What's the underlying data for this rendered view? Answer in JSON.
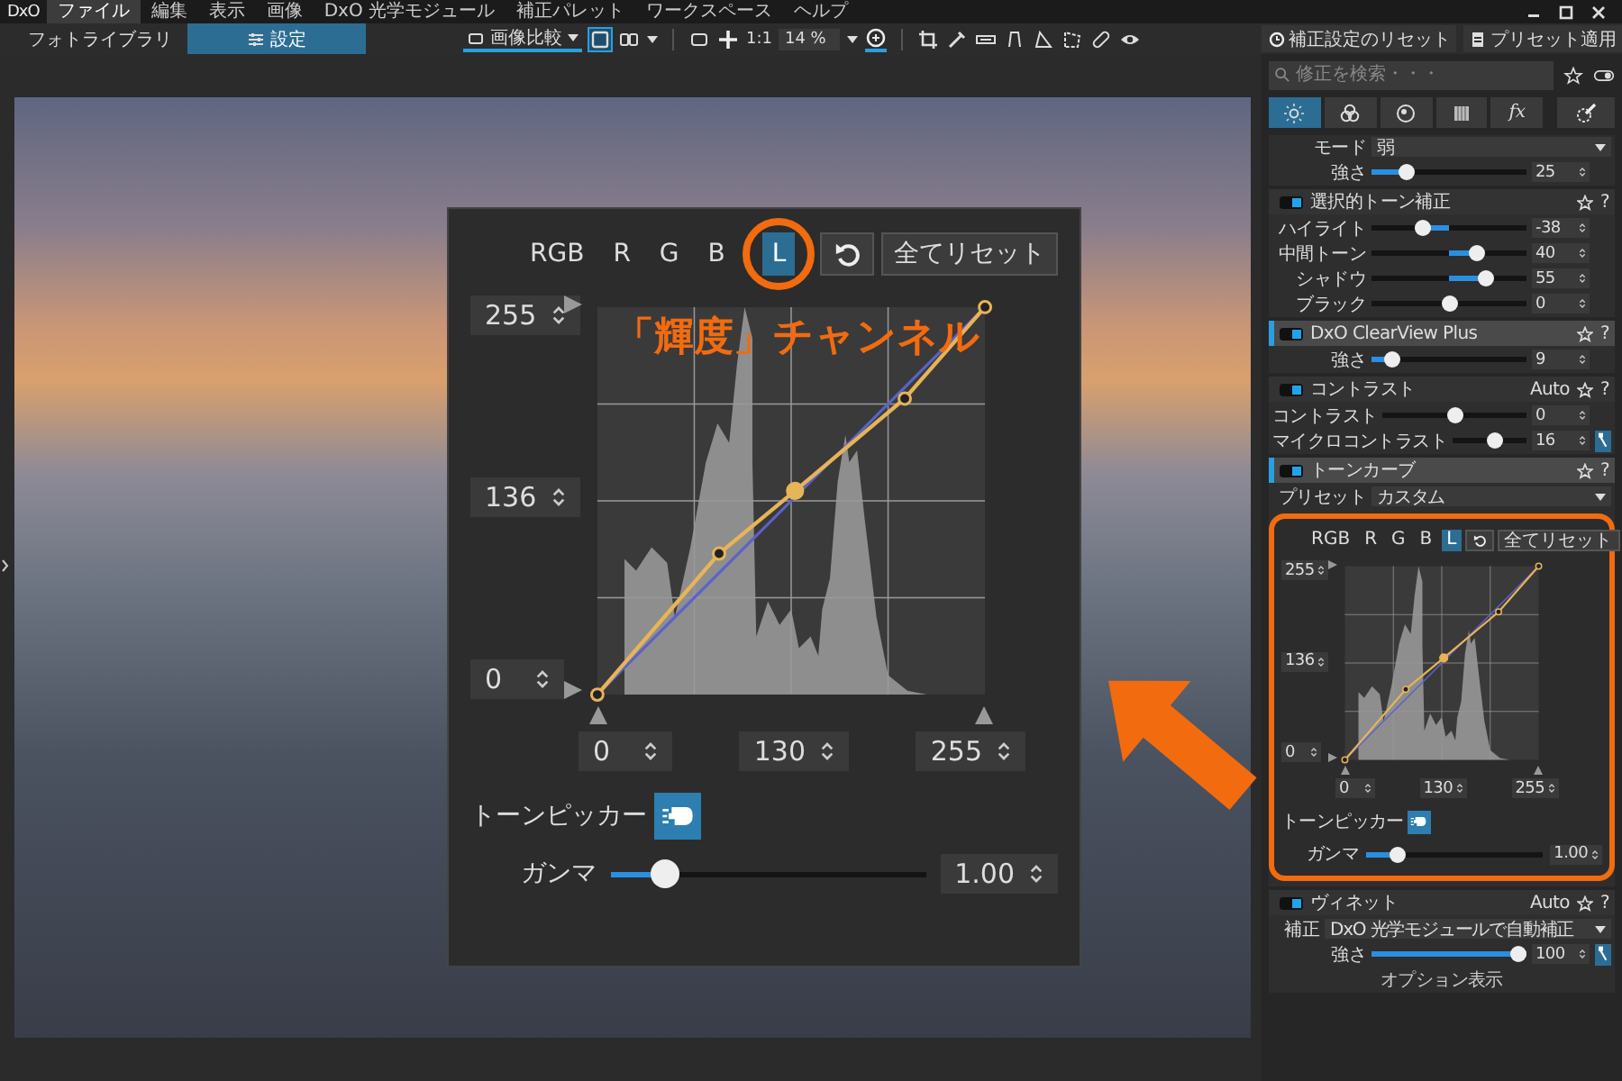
{
  "menu": {
    "logo": "DxO",
    "items": [
      {
        "label": "ファイル",
        "selected": true
      },
      {
        "label": "編集",
        "selected": false
      },
      {
        "label": "表示",
        "selected": false
      },
      {
        "label": "画像",
        "selected": false
      },
      {
        "label": "DxO 光学モジュール",
        "selected": false
      },
      {
        "label": "補正パレット",
        "selected": false
      },
      {
        "label": "ワークスペース",
        "selected": false
      },
      {
        "label": "ヘルプ",
        "selected": false
      }
    ]
  },
  "toolbar": {
    "tabs": [
      {
        "label": "フォトライブラリ",
        "selected": false
      },
      {
        "label": "設定",
        "selected": true
      }
    ],
    "compare": {
      "label": "画像比較",
      "selected": true
    },
    "zoom_ratio": "1:1",
    "zoom": "14 %",
    "reset_button": "補正設定のリセット",
    "preset_button": "プリセット適用"
  },
  "inset": {
    "circle_selected": true,
    "annotation": "「輝度」チャンネル",
    "channels": [
      {
        "label": "RGB",
        "selected": false
      },
      {
        "label": "R",
        "selected": false
      },
      {
        "label": "G",
        "selected": false
      },
      {
        "label": "B",
        "selected": false
      },
      {
        "label": "L",
        "selected": true
      }
    ],
    "reset_all": "全てリセット",
    "y_values": [
      "255",
      "136",
      "0"
    ],
    "x_values": [
      "0",
      "130",
      "255"
    ],
    "picker_label": "トーンピッカー",
    "gamma": {
      "label": "ガンマ",
      "level": 0.14,
      "value": "1.00"
    }
  },
  "palette": {
    "search": {
      "placeholder": "修正を検索・・・"
    },
    "tabs": [
      {
        "kind": "light",
        "selected": true
      },
      {
        "kind": "color",
        "selected": false
      },
      {
        "kind": "detail",
        "selected": false
      },
      {
        "kind": "geometry",
        "selected": false
      },
      {
        "kind": "effects",
        "label": "fx",
        "selected": false
      }
    ],
    "sections": [
      {
        "rows": [
          {
            "kind": "dropdown",
            "label": "モード",
            "value": "弱"
          },
          {
            "kind": "slider",
            "label": "強さ",
            "level": 0.2,
            "value": "25"
          }
        ]
      },
      {
        "title": "選択的トーン補正",
        "on": true,
        "selected": false,
        "help": "?",
        "rows": [
          {
            "kind": "bipolar",
            "label": "ハイライト",
            "level": 0.31,
            "value": "-38"
          },
          {
            "kind": "bipolar",
            "label": "中間トーン",
            "level": 0.7,
            "value": "40"
          },
          {
            "kind": "bipolar",
            "label": "シャドウ",
            "level": 0.77,
            "value": "55"
          },
          {
            "kind": "bipolar",
            "label": "ブラック",
            "level": 0.5,
            "value": "0"
          }
        ]
      },
      {
        "title": "DxO ClearView Plus",
        "on": true,
        "selected": true,
        "help": "?",
        "rows": [
          {
            "kind": "slider",
            "label": "強さ",
            "level": 0.09,
            "value": "9"
          }
        ]
      },
      {
        "title": "コントラスト",
        "on": true,
        "selected": false,
        "auto": "Auto",
        "help": "?",
        "rows": [
          {
            "kind": "bipolar",
            "label": "コントラスト",
            "level": 0.5,
            "value": "0"
          },
          {
            "kind": "bipolar",
            "label": "マイクロコントラスト",
            "level": 0.58,
            "value": "16",
            "wand": true
          }
        ]
      },
      {
        "title": "トーンカーブ",
        "on": true,
        "selected": true,
        "help": "?",
        "rows": [
          {
            "kind": "dropdown",
            "label": "プリセット",
            "value": "カスタム"
          },
          {
            "kind": "curve",
            "highlighted": true,
            "channels": [
              {
                "label": "RGB",
                "selected": false
              },
              {
                "label": "R",
                "selected": false
              },
              {
                "label": "G",
                "selected": false
              },
              {
                "label": "B",
                "selected": false
              },
              {
                "label": "L",
                "selected": true
              }
            ],
            "reset_all": "全てリセット",
            "y_values": [
              "255",
              "136",
              "0"
            ],
            "x_values": [
              "0",
              "130",
              "255"
            ],
            "picker_label": "トーンピッカー",
            "gamma": {
              "label": "ガンマ",
              "level": 0.14,
              "value": "1.00"
            }
          }
        ]
      },
      {
        "title": "ヴィネット",
        "on": true,
        "selected": false,
        "auto": "Auto",
        "help": "?",
        "rows": [
          {
            "kind": "dropdown",
            "label": "補正",
            "value": "DxO 光学モジュールで自動補正"
          },
          {
            "kind": "slider",
            "label": "強さ",
            "level": 1,
            "value": "100",
            "wand": true
          },
          {
            "kind": "link",
            "label": "オプション表示"
          }
        ]
      }
    ]
  }
}
